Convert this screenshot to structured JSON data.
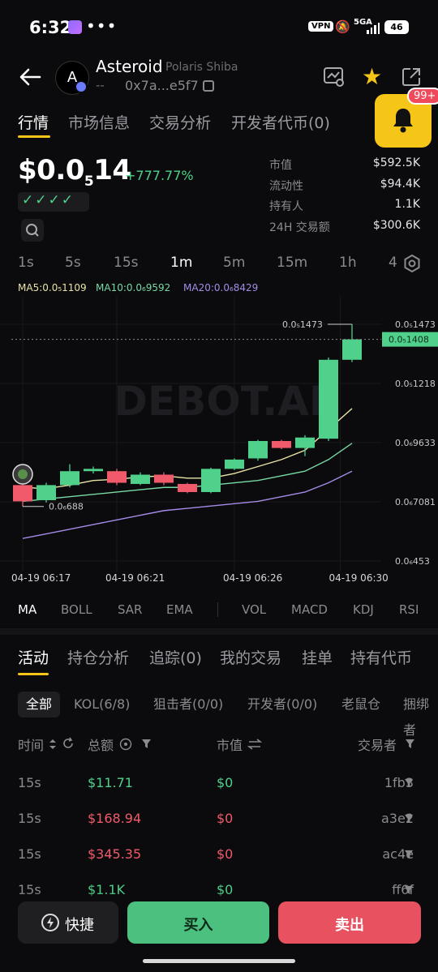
{
  "status_bar": {
    "time": "6:32",
    "dots": "•••",
    "vpn": "VPN",
    "network": "5GA",
    "battery": "46"
  },
  "header": {
    "token_initial": "A",
    "token_name": "Asteroid",
    "token_subname": "Polaris Shiba",
    "dashes": "--",
    "address": "0x7a...e5f7"
  },
  "notifications": {
    "count": "99+"
  },
  "tabs": [
    {
      "label": "行情"
    },
    {
      "label": "市场信息"
    },
    {
      "label": "交易分析"
    },
    {
      "label": "开发者代币(0)"
    }
  ],
  "price": {
    "prefix": "$0.0",
    "zeros": "5",
    "digits": "14",
    "change": "+777.77%",
    "checks": "✓✓✓✓"
  },
  "stats": [
    {
      "label": "市值",
      "value": "$592.5K"
    },
    {
      "label": "流动性",
      "value": "$94.4K"
    },
    {
      "label": "持有人",
      "value": "1.1K"
    },
    {
      "label": "24H 交易额",
      "value": "$300.6K"
    }
  ],
  "timeframes": [
    "1s",
    "5s",
    "15s",
    "1m",
    "5m",
    "15m",
    "1h",
    "4"
  ],
  "ma_legend": {
    "ma5": "MA5:0.0₅1109",
    "ma10": "MA10:0.0₆9592",
    "ma20": "MA20:0.0₆8429"
  },
  "colors": {
    "up": "#4fd18b",
    "down": "#f05a6a",
    "accent": "#f5c518",
    "ma5": "#e9e3a6",
    "ma10": "#78d9a4",
    "ma20": "#a58be8"
  },
  "chart_data": {
    "type": "candlestick",
    "watermark": "DEBOT.AI",
    "y_ticks": [
      "0.0₅1473",
      "0.0₅1218",
      "0.0₆9633",
      "0.0₆7081",
      "0.0₆453"
    ],
    "y_tick_values": [
      1.473e-05,
      1.218e-05,
      9.633e-06,
      7.081e-06,
      4.53e-06
    ],
    "ylim": [
      4.53e-06,
      1.473e-05
    ],
    "x_ticks": [
      "04-19 06:17",
      "04-19 06:21",
      "04-19 06:26",
      "04-19 06:30"
    ],
    "x_tick_index": [
      0,
      4,
      9,
      13.5
    ],
    "current_price_label": "0.0₅1408",
    "current_price": 1.408e-05,
    "max_label": "0.0₅1473",
    "min_label": "0.0₆688",
    "min_value": 6.88e-06,
    "candles": [
      {
        "o": 7.8e-06,
        "c": 7.1e-06,
        "h": 7.9e-06,
        "l": 6.88e-06
      },
      {
        "o": 7.15e-06,
        "c": 7.8e-06,
        "h": 7.9e-06,
        "l": 7.05e-06
      },
      {
        "o": 7.8e-06,
        "c": 8.4e-06,
        "h": 8.7e-06,
        "l": 7.7e-06
      },
      {
        "o": 8.4e-06,
        "c": 8.5e-06,
        "h": 8.6e-06,
        "l": 8.3e-06
      },
      {
        "o": 8.4e-06,
        "c": 7.9e-06,
        "h": 8.5e-06,
        "l": 7.8e-06
      },
      {
        "o": 7.85e-06,
        "c": 8.25e-06,
        "h": 8.35e-06,
        "l": 7.8e-06
      },
      {
        "o": 8.25e-06,
        "c": 7.9e-06,
        "h": 8.35e-06,
        "l": 7.8e-06
      },
      {
        "o": 7.85e-06,
        "c": 7.5e-06,
        "h": 7.9e-06,
        "l": 7.45e-06
      },
      {
        "o": 7.5e-06,
        "c": 8.5e-06,
        "h": 8.55e-06,
        "l": 7.45e-06
      },
      {
        "o": 8.5e-06,
        "c": 8.9e-06,
        "h": 8.95e-06,
        "l": 8.45e-06
      },
      {
        "o": 8.95e-06,
        "c": 9.7e-06,
        "h": 9.75e-06,
        "l": 8.85e-06
      },
      {
        "o": 9.7e-06,
        "c": 9.4e-06,
        "h": 9.75e-06,
        "l": 9.35e-06
      },
      {
        "o": 9.4e-06,
        "c": 9.85e-06,
        "h": 9.95e-06,
        "l": 9.05e-06
      },
      {
        "o": 9.8e-06,
        "c": 1.32e-05,
        "h": 1.33e-05,
        "l": 9.7e-06
      },
      {
        "o": 1.32e-05,
        "c": 1.408e-05,
        "h": 1.473e-05,
        "l": 1.31e-05
      }
    ],
    "series": [
      {
        "name": "MA5",
        "values": [
          7.7e-06,
          7.65e-06,
          7.8e-06,
          8e-06,
          8.05e-06,
          8.15e-06,
          8.2e-06,
          8.1e-06,
          8.1e-06,
          8.3e-06,
          8.6e-06,
          8.9e-06,
          9.3e-06,
          1.02e-05,
          1.11e-05
        ]
      },
      {
        "name": "MA10",
        "values": [
          7.1e-06,
          7.2e-06,
          7.3e-06,
          7.4e-06,
          7.5e-06,
          7.6e-06,
          7.7e-06,
          7.7e-06,
          7.8e-06,
          7.9e-06,
          8e-06,
          8.2e-06,
          8.4e-06,
          8.9e-06,
          9.6e-06
        ]
      },
      {
        "name": "MA20",
        "values": [
          5.5e-06,
          5.7e-06,
          5.9e-06,
          6.1e-06,
          6.3e-06,
          6.5e-06,
          6.7e-06,
          6.8e-06,
          6.9e-06,
          7e-06,
          7.1e-06,
          7.3e-06,
          7.5e-06,
          7.9e-06,
          8.4e-06
        ]
      }
    ]
  },
  "indicators": [
    "MA",
    "BOLL",
    "SAR",
    "EMA",
    "VOL",
    "MACD",
    "KDJ",
    "RSI"
  ],
  "activity_tabs": [
    "活动",
    "持仓分析",
    "追踪(0)",
    "我的交易",
    "挂单",
    "持有代币"
  ],
  "filter_chips": [
    "全部",
    "KOL(6/8)",
    "狙击者(0/0)",
    "开发者(0/0)",
    "老鼠仓",
    "捆绑者"
  ],
  "table": {
    "headers": {
      "time": "时间",
      "amount": "总额",
      "mcap": "市值",
      "trader": "交易者"
    },
    "rows": [
      {
        "time": "15s",
        "amount": "$11.71",
        "side": "buy",
        "mcap": "$0",
        "trader": "1fb3"
      },
      {
        "time": "15s",
        "amount": "$168.94",
        "side": "sell",
        "mcap": "$0",
        "trader": "a3e2"
      },
      {
        "time": "15s",
        "amount": "$345.35",
        "side": "sell",
        "mcap": "$0",
        "trader": "ac4e"
      },
      {
        "time": "15s",
        "amount": "$1.1K",
        "side": "buy",
        "mcap": "$0",
        "trader": "ff6f"
      }
    ]
  },
  "actions": {
    "quick": "快捷",
    "buy": "买入",
    "sell": "卖出"
  }
}
